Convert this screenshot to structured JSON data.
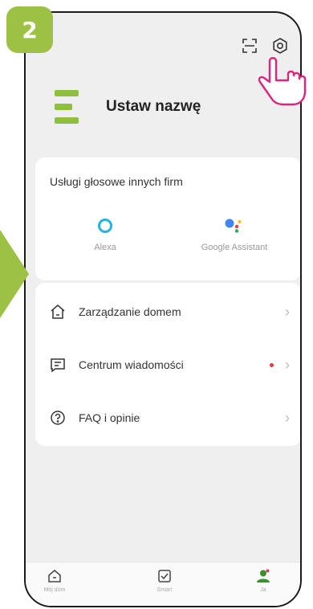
{
  "step": {
    "number": "2"
  },
  "header": {
    "icons": [
      "scan-icon",
      "settings-icon"
    ]
  },
  "profile": {
    "name": "Ustaw nazwę"
  },
  "voice_services": {
    "title": "Usługi głosowe innych firm",
    "items": [
      {
        "label": "Alexa",
        "icon": "alexa-icon"
      },
      {
        "label": "Google Assistant",
        "icon": "google-assistant-icon"
      }
    ]
  },
  "menu": {
    "items": [
      {
        "label": "Zarządzanie domem",
        "icon": "home-icon"
      },
      {
        "label": "Centrum wiadomości",
        "icon": "message-icon",
        "unread": true
      },
      {
        "label": "FAQ i opinie",
        "icon": "help-icon"
      }
    ]
  },
  "bottom_nav": {
    "items": [
      {
        "label": "Mój dom",
        "icon": "home-icon"
      },
      {
        "label": "Smart",
        "icon": "checkbox-icon"
      },
      {
        "label": "Ja",
        "icon": "profile-icon",
        "active": true
      }
    ]
  },
  "colors": {
    "accent": "#9cc144",
    "brand_green": "#8fbf3e",
    "hand": "#e0247a",
    "dot": "#e4394a"
  }
}
